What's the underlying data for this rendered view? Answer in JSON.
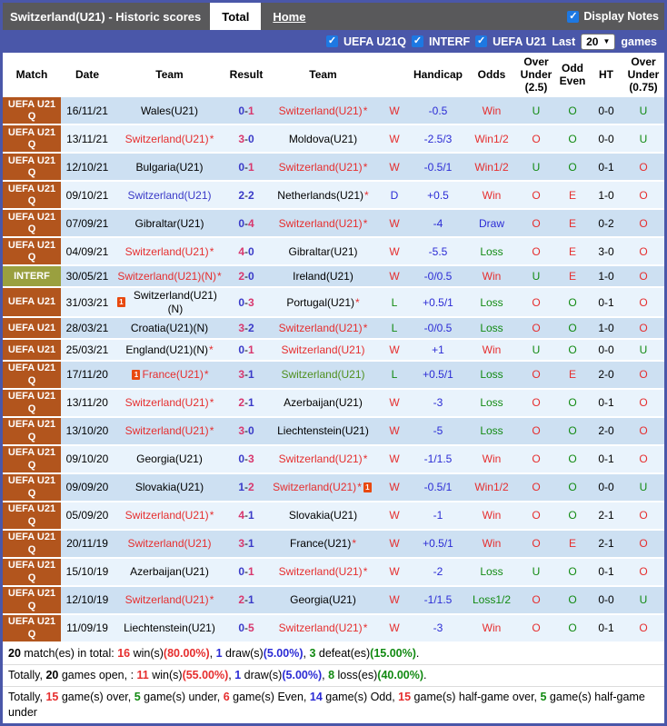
{
  "colors": {
    "k": "#000000",
    "r": "#e62e2e",
    "g": "#128a12",
    "b": "#2b2bd5",
    "sr": "#d8376d",
    "sb": "#3a3ac8",
    "tg": "#4f8f1f"
  },
  "title_bar": {
    "title": "Switzerland(U21) - Historic scores",
    "tab_total": "Total",
    "tab_home": "Home",
    "display_notes_label": "Display Notes",
    "display_notes_checked": true
  },
  "filter_bar": {
    "checkboxes": [
      {
        "label": "UEFA U21Q",
        "checked": true
      },
      {
        "label": "INTERF",
        "checked": true
      },
      {
        "label": "UEFA U21",
        "checked": true
      }
    ],
    "last_label": "Last",
    "games_count": "20",
    "games_label": "games"
  },
  "table": {
    "headers": [
      "Match",
      "Date",
      "Team",
      "Result",
      "Team",
      "",
      "Handicap",
      "Odds",
      "Over Under (2.5)",
      "Odd Even",
      "HT",
      "Over Under (0.75)"
    ],
    "rows": [
      {
        "league": "UEFA U21 Q",
        "lg": "uefa",
        "date": "16/11/21",
        "home": {
          "name": "Wales(U21)",
          "c": "k"
        },
        "score": {
          "h": "0",
          "a": "1",
          "hc": "sb",
          "ac": "sr"
        },
        "away": {
          "name": "Switzerland(U21)",
          "c": "r",
          "star": true
        },
        "wdl": {
          "t": "W",
          "c": "r"
        },
        "handicap": "-0.5",
        "odds": {
          "t": "Win",
          "c": "r"
        },
        "ou25": {
          "t": "U",
          "c": "g"
        },
        "oe": {
          "t": "O",
          "c": "g"
        },
        "ht": "0-0",
        "ou075": {
          "t": "U",
          "c": "g"
        }
      },
      {
        "league": "UEFA U21 Q",
        "lg": "uefa",
        "date": "13/11/21",
        "home": {
          "name": "Switzerland(U21)",
          "c": "r",
          "star": true
        },
        "score": {
          "h": "3",
          "a": "0",
          "hc": "sr",
          "ac": "sb"
        },
        "away": {
          "name": "Moldova(U21)",
          "c": "k"
        },
        "wdl": {
          "t": "W",
          "c": "r"
        },
        "handicap": "-2.5/3",
        "odds": {
          "t": "Win1/2",
          "c": "r"
        },
        "ou25": {
          "t": "O",
          "c": "r"
        },
        "oe": {
          "t": "O",
          "c": "g"
        },
        "ht": "0-0",
        "ou075": {
          "t": "U",
          "c": "g"
        }
      },
      {
        "league": "UEFA U21 Q",
        "lg": "uefa",
        "date": "12/10/21",
        "home": {
          "name": "Bulgaria(U21)",
          "c": "k"
        },
        "score": {
          "h": "0",
          "a": "1",
          "hc": "sb",
          "ac": "sr"
        },
        "away": {
          "name": "Switzerland(U21)",
          "c": "r",
          "star": true
        },
        "wdl": {
          "t": "W",
          "c": "r"
        },
        "handicap": "-0.5/1",
        "odds": {
          "t": "Win1/2",
          "c": "r"
        },
        "ou25": {
          "t": "U",
          "c": "g"
        },
        "oe": {
          "t": "O",
          "c": "g"
        },
        "ht": "0-1",
        "ou075": {
          "t": "O",
          "c": "r"
        }
      },
      {
        "league": "UEFA U21 Q",
        "lg": "uefa",
        "date": "09/10/21",
        "home": {
          "name": "Switzerland(U21)",
          "c": "sb"
        },
        "score": {
          "h": "2",
          "a": "2",
          "hc": "sb",
          "ac": "sb"
        },
        "away": {
          "name": "Netherlands(U21)",
          "c": "k",
          "star": true
        },
        "wdl": {
          "t": "D",
          "c": "b"
        },
        "handicap": "+0.5",
        "odds": {
          "t": "Win",
          "c": "r"
        },
        "ou25": {
          "t": "O",
          "c": "r"
        },
        "oe": {
          "t": "E",
          "c": "r"
        },
        "ht": "1-0",
        "ou075": {
          "t": "O",
          "c": "r"
        }
      },
      {
        "league": "UEFA U21 Q",
        "lg": "uefa",
        "date": "07/09/21",
        "home": {
          "name": "Gibraltar(U21)",
          "c": "k"
        },
        "score": {
          "h": "0",
          "a": "4",
          "hc": "sb",
          "ac": "sr"
        },
        "away": {
          "name": "Switzerland(U21)",
          "c": "r",
          "star": true
        },
        "wdl": {
          "t": "W",
          "c": "r"
        },
        "handicap": "-4",
        "odds": {
          "t": "Draw",
          "c": "b"
        },
        "ou25": {
          "t": "O",
          "c": "r"
        },
        "oe": {
          "t": "E",
          "c": "r"
        },
        "ht": "0-2",
        "ou075": {
          "t": "O",
          "c": "r"
        }
      },
      {
        "league": "UEFA U21 Q",
        "lg": "uefa",
        "date": "04/09/21",
        "home": {
          "name": "Switzerland(U21)",
          "c": "r",
          "star": true
        },
        "score": {
          "h": "4",
          "a": "0",
          "hc": "sr",
          "ac": "sb"
        },
        "away": {
          "name": "Gibraltar(U21)",
          "c": "k"
        },
        "wdl": {
          "t": "W",
          "c": "r"
        },
        "handicap": "-5.5",
        "odds": {
          "t": "Loss",
          "c": "g"
        },
        "ou25": {
          "t": "O",
          "c": "r"
        },
        "oe": {
          "t": "E",
          "c": "r"
        },
        "ht": "3-0",
        "ou075": {
          "t": "O",
          "c": "r"
        }
      },
      {
        "league": "INTERF",
        "lg": "interf",
        "date": "30/05/21",
        "home": {
          "name": "Switzerland(U21)(N)",
          "c": "r",
          "star": true
        },
        "score": {
          "h": "2",
          "a": "0",
          "hc": "sr",
          "ac": "sb"
        },
        "away": {
          "name": "Ireland(U21)",
          "c": "k"
        },
        "wdl": {
          "t": "W",
          "c": "r"
        },
        "handicap": "-0/0.5",
        "odds": {
          "t": "Win",
          "c": "r"
        },
        "ou25": {
          "t": "U",
          "c": "g"
        },
        "oe": {
          "t": "E",
          "c": "r"
        },
        "ht": "1-0",
        "ou075": {
          "t": "O",
          "c": "r"
        }
      },
      {
        "league": "UEFA U21",
        "lg": "uefa",
        "date": "31/03/21",
        "home": {
          "name": "Switzerland(U21)(N)",
          "c": "k",
          "icon": "before"
        },
        "score": {
          "h": "0",
          "a": "3",
          "hc": "sb",
          "ac": "sr"
        },
        "away": {
          "name": "Portugal(U21)",
          "c": "k",
          "star": true
        },
        "wdl": {
          "t": "L",
          "c": "g"
        },
        "handicap": "+0.5/1",
        "odds": {
          "t": "Loss",
          "c": "g"
        },
        "ou25": {
          "t": "O",
          "c": "r"
        },
        "oe": {
          "t": "O",
          "c": "g"
        },
        "ht": "0-1",
        "ou075": {
          "t": "O",
          "c": "r"
        }
      },
      {
        "league": "UEFA U21",
        "lg": "uefa",
        "date": "28/03/21",
        "home": {
          "name": "Croatia(U21)(N)",
          "c": "k"
        },
        "score": {
          "h": "3",
          "a": "2",
          "hc": "sr",
          "ac": "sb"
        },
        "away": {
          "name": "Switzerland(U21)",
          "c": "r",
          "star": true
        },
        "wdl": {
          "t": "L",
          "c": "g"
        },
        "handicap": "-0/0.5",
        "odds": {
          "t": "Loss",
          "c": "g"
        },
        "ou25": {
          "t": "O",
          "c": "r"
        },
        "oe": {
          "t": "O",
          "c": "g"
        },
        "ht": "1-0",
        "ou075": {
          "t": "O",
          "c": "r"
        }
      },
      {
        "league": "UEFA U21",
        "lg": "uefa",
        "date": "25/03/21",
        "home": {
          "name": "England(U21)(N)",
          "c": "k",
          "star": true
        },
        "score": {
          "h": "0",
          "a": "1",
          "hc": "sb",
          "ac": "sr"
        },
        "away": {
          "name": "Switzerland(U21)",
          "c": "r"
        },
        "wdl": {
          "t": "W",
          "c": "r"
        },
        "handicap": "+1",
        "odds": {
          "t": "Win",
          "c": "r"
        },
        "ou25": {
          "t": "U",
          "c": "g"
        },
        "oe": {
          "t": "O",
          "c": "g"
        },
        "ht": "0-0",
        "ou075": {
          "t": "U",
          "c": "g"
        }
      },
      {
        "league": "UEFA U21 Q",
        "lg": "uefa",
        "date": "17/11/20",
        "home": {
          "name": "France(U21)",
          "c": "r",
          "star": true,
          "icon": "before"
        },
        "score": {
          "h": "3",
          "a": "1",
          "hc": "sr",
          "ac": "sb"
        },
        "away": {
          "name": "Switzerland(U21)",
          "c": "tg"
        },
        "wdl": {
          "t": "L",
          "c": "g"
        },
        "handicap": "+0.5/1",
        "odds": {
          "t": "Loss",
          "c": "g"
        },
        "ou25": {
          "t": "O",
          "c": "r"
        },
        "oe": {
          "t": "E",
          "c": "r"
        },
        "ht": "2-0",
        "ou075": {
          "t": "O",
          "c": "r"
        }
      },
      {
        "league": "UEFA U21 Q",
        "lg": "uefa",
        "date": "13/11/20",
        "home": {
          "name": "Switzerland(U21)",
          "c": "r",
          "star": true
        },
        "score": {
          "h": "2",
          "a": "1",
          "hc": "sr",
          "ac": "sb"
        },
        "away": {
          "name": "Azerbaijan(U21)",
          "c": "k"
        },
        "wdl": {
          "t": "W",
          "c": "r"
        },
        "handicap": "-3",
        "odds": {
          "t": "Loss",
          "c": "g"
        },
        "ou25": {
          "t": "O",
          "c": "r"
        },
        "oe": {
          "t": "O",
          "c": "g"
        },
        "ht": "0-1",
        "ou075": {
          "t": "O",
          "c": "r"
        }
      },
      {
        "league": "UEFA U21 Q",
        "lg": "uefa",
        "date": "13/10/20",
        "home": {
          "name": "Switzerland(U21)",
          "c": "r",
          "star": true
        },
        "score": {
          "h": "3",
          "a": "0",
          "hc": "sr",
          "ac": "sb"
        },
        "away": {
          "name": "Liechtenstein(U21)",
          "c": "k"
        },
        "wdl": {
          "t": "W",
          "c": "r"
        },
        "handicap": "-5",
        "odds": {
          "t": "Loss",
          "c": "g"
        },
        "ou25": {
          "t": "O",
          "c": "r"
        },
        "oe": {
          "t": "O",
          "c": "g"
        },
        "ht": "2-0",
        "ou075": {
          "t": "O",
          "c": "r"
        }
      },
      {
        "league": "UEFA U21 Q",
        "lg": "uefa",
        "date": "09/10/20",
        "home": {
          "name": "Georgia(U21)",
          "c": "k"
        },
        "score": {
          "h": "0",
          "a": "3",
          "hc": "sb",
          "ac": "sr"
        },
        "away": {
          "name": "Switzerland(U21)",
          "c": "r",
          "star": true
        },
        "wdl": {
          "t": "W",
          "c": "r"
        },
        "handicap": "-1/1.5",
        "odds": {
          "t": "Win",
          "c": "r"
        },
        "ou25": {
          "t": "O",
          "c": "r"
        },
        "oe": {
          "t": "O",
          "c": "g"
        },
        "ht": "0-1",
        "ou075": {
          "t": "O",
          "c": "r"
        }
      },
      {
        "league": "UEFA U21 Q",
        "lg": "uefa",
        "date": "09/09/20",
        "home": {
          "name": "Slovakia(U21)",
          "c": "k"
        },
        "score": {
          "h": "1",
          "a": "2",
          "hc": "sb",
          "ac": "sr"
        },
        "away": {
          "name": "Switzerland(U21)",
          "c": "r",
          "star": true,
          "icon": "after"
        },
        "wdl": {
          "t": "W",
          "c": "r"
        },
        "handicap": "-0.5/1",
        "odds": {
          "t": "Win1/2",
          "c": "r"
        },
        "ou25": {
          "t": "O",
          "c": "r"
        },
        "oe": {
          "t": "O",
          "c": "g"
        },
        "ht": "0-0",
        "ou075": {
          "t": "U",
          "c": "g"
        }
      },
      {
        "league": "UEFA U21 Q",
        "lg": "uefa",
        "date": "05/09/20",
        "home": {
          "name": "Switzerland(U21)",
          "c": "r",
          "star": true
        },
        "score": {
          "h": "4",
          "a": "1",
          "hc": "sr",
          "ac": "sb"
        },
        "away": {
          "name": "Slovakia(U21)",
          "c": "k"
        },
        "wdl": {
          "t": "W",
          "c": "r"
        },
        "handicap": "-1",
        "odds": {
          "t": "Win",
          "c": "r"
        },
        "ou25": {
          "t": "O",
          "c": "r"
        },
        "oe": {
          "t": "O",
          "c": "g"
        },
        "ht": "2-1",
        "ou075": {
          "t": "O",
          "c": "r"
        }
      },
      {
        "league": "UEFA U21 Q",
        "lg": "uefa",
        "date": "20/11/19",
        "home": {
          "name": "Switzerland(U21)",
          "c": "r"
        },
        "score": {
          "h": "3",
          "a": "1",
          "hc": "sr",
          "ac": "sb"
        },
        "away": {
          "name": "France(U21)",
          "c": "k",
          "star": true
        },
        "wdl": {
          "t": "W",
          "c": "r"
        },
        "handicap": "+0.5/1",
        "odds": {
          "t": "Win",
          "c": "r"
        },
        "ou25": {
          "t": "O",
          "c": "r"
        },
        "oe": {
          "t": "E",
          "c": "r"
        },
        "ht": "2-1",
        "ou075": {
          "t": "O",
          "c": "r"
        }
      },
      {
        "league": "UEFA U21 Q",
        "lg": "uefa",
        "date": "15/10/19",
        "home": {
          "name": "Azerbaijan(U21)",
          "c": "k"
        },
        "score": {
          "h": "0",
          "a": "1",
          "hc": "sb",
          "ac": "sr"
        },
        "away": {
          "name": "Switzerland(U21)",
          "c": "r",
          "star": true
        },
        "wdl": {
          "t": "W",
          "c": "r"
        },
        "handicap": "-2",
        "odds": {
          "t": "Loss",
          "c": "g"
        },
        "ou25": {
          "t": "U",
          "c": "g"
        },
        "oe": {
          "t": "O",
          "c": "g"
        },
        "ht": "0-1",
        "ou075": {
          "t": "O",
          "c": "r"
        }
      },
      {
        "league": "UEFA U21 Q",
        "lg": "uefa",
        "date": "12/10/19",
        "home": {
          "name": "Switzerland(U21)",
          "c": "r",
          "star": true
        },
        "score": {
          "h": "2",
          "a": "1",
          "hc": "sr",
          "ac": "sb"
        },
        "away": {
          "name": "Georgia(U21)",
          "c": "k"
        },
        "wdl": {
          "t": "W",
          "c": "r"
        },
        "handicap": "-1/1.5",
        "odds": {
          "t": "Loss1/2",
          "c": "g"
        },
        "ou25": {
          "t": "O",
          "c": "r"
        },
        "oe": {
          "t": "O",
          "c": "g"
        },
        "ht": "0-0",
        "ou075": {
          "t": "U",
          "c": "g"
        }
      },
      {
        "league": "UEFA U21 Q",
        "lg": "uefa",
        "date": "11/09/19",
        "home": {
          "name": "Liechtenstein(U21)",
          "c": "k"
        },
        "score": {
          "h": "0",
          "a": "5",
          "hc": "sb",
          "ac": "sr"
        },
        "away": {
          "name": "Switzerland(U21)",
          "c": "r",
          "star": true
        },
        "wdl": {
          "t": "W",
          "c": "r"
        },
        "handicap": "-3",
        "odds": {
          "t": "Win",
          "c": "r"
        },
        "ou25": {
          "t": "O",
          "c": "r"
        },
        "oe": {
          "t": "O",
          "c": "g"
        },
        "ht": "0-1",
        "ou075": {
          "t": "O",
          "c": "r"
        }
      }
    ]
  },
  "footer": {
    "lines": [
      [
        {
          "t": "20",
          "c": "k",
          "b": 1
        },
        {
          "t": " match(es) in total: "
        },
        {
          "t": "16",
          "c": "r",
          "b": 1
        },
        {
          "t": " win(s)"
        },
        {
          "t": "(80.00%)",
          "c": "r",
          "b": 1
        },
        {
          "t": ", "
        },
        {
          "t": "1",
          "c": "b",
          "b": 1
        },
        {
          "t": " draw(s)"
        },
        {
          "t": "(5.00%)",
          "c": "b",
          "b": 1
        },
        {
          "t": ", "
        },
        {
          "t": "3",
          "c": "g",
          "b": 1
        },
        {
          "t": " defeat(es)"
        },
        {
          "t": "(15.00%)",
          "c": "g",
          "b": 1
        },
        {
          "t": "."
        }
      ],
      [
        {
          "t": "Totally, "
        },
        {
          "t": "20",
          "c": "k",
          "b": 1
        },
        {
          "t": " games open, : "
        },
        {
          "t": "11",
          "c": "r",
          "b": 1
        },
        {
          "t": " win(s)"
        },
        {
          "t": "(55.00%)",
          "c": "r",
          "b": 1
        },
        {
          "t": ", "
        },
        {
          "t": "1",
          "c": "b",
          "b": 1
        },
        {
          "t": " draw(s)"
        },
        {
          "t": "(5.00%)",
          "c": "b",
          "b": 1
        },
        {
          "t": ", "
        },
        {
          "t": "8",
          "c": "g",
          "b": 1
        },
        {
          "t": " loss(es)"
        },
        {
          "t": "(40.00%)",
          "c": "g",
          "b": 1
        },
        {
          "t": "."
        }
      ],
      [
        {
          "t": "Totally, "
        },
        {
          "t": "15",
          "c": "r",
          "b": 1
        },
        {
          "t": " game(s) over, "
        },
        {
          "t": "5",
          "c": "g",
          "b": 1
        },
        {
          "t": " game(s) under, "
        },
        {
          "t": "6",
          "c": "r",
          "b": 1
        },
        {
          "t": " game(s) Even, "
        },
        {
          "t": "14",
          "c": "b",
          "b": 1
        },
        {
          "t": " game(s) Odd, "
        },
        {
          "t": "15",
          "c": "r",
          "b": 1
        },
        {
          "t": " game(s) half-game over, "
        },
        {
          "t": "5",
          "c": "g",
          "b": 1
        },
        {
          "t": " game(s) half-game under"
        }
      ]
    ]
  }
}
